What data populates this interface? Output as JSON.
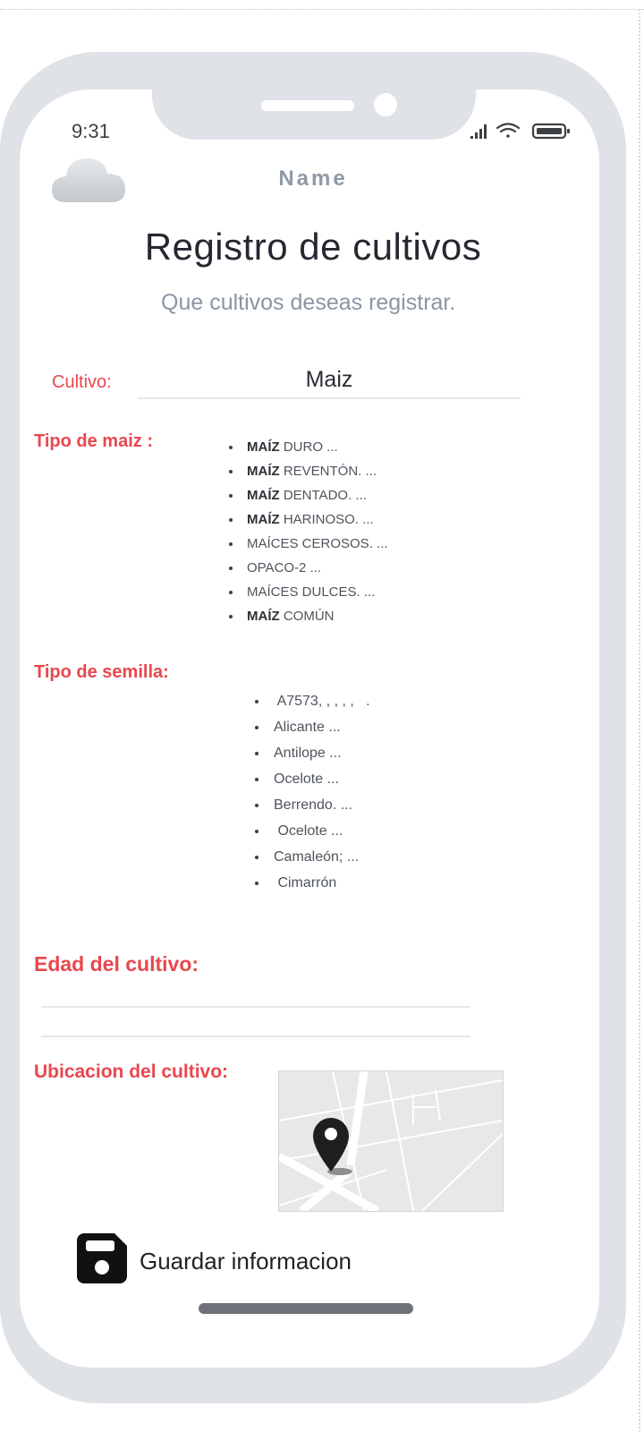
{
  "status_bar": {
    "time": "9:31",
    "icons": [
      "signal-icon",
      "wifi-icon",
      "battery-icon"
    ]
  },
  "header": {
    "logo_icon": "cloud-icon",
    "name": "Name",
    "title": "Registro de cultivos",
    "subtitle": "Que cultivos deseas registrar."
  },
  "form": {
    "cultivo": {
      "label": "Cultivo:",
      "value": "Maiz"
    },
    "tipo_maiz": {
      "label": "Tipo de maiz :",
      "items": [
        {
          "bold": "MAÍZ",
          "text": " DURO ..."
        },
        {
          "bold": "MAÍZ",
          "text": " REVENTÓN. ..."
        },
        {
          "bold": "MAÍZ",
          "text": " DENTADO. ..."
        },
        {
          "bold": "MAÍZ",
          "text": " HARINOSO. ..."
        },
        {
          "bold": "",
          "text": "MAÍCES CEROSOS. ..."
        },
        {
          "bold": "",
          "text": "OPACO-2 ..."
        },
        {
          "bold": "",
          "text": "MAÍCES DULCES. ..."
        },
        {
          "bold": "MAÍZ",
          "text": " COMÚN"
        }
      ]
    },
    "tipo_semilla": {
      "label": "Tipo de semilla:",
      "items": [
        " A7573, , , , ,   .",
        "Alicante ...",
        "Antilope ...",
        "Ocelote ...",
        "Berrendo. ...",
        " Ocelote ...",
        "Camaleón; ...",
        " Cimarrón"
      ]
    },
    "edad": {
      "label": "Edad del cultivo:",
      "value": ""
    },
    "ubicacion": {
      "label": "Ubicacion del cultivo:",
      "map_icon": "map-pin-icon"
    }
  },
  "actions": {
    "save_icon": "floppy-disk-icon",
    "save_label": "Guardar informacion"
  },
  "colors": {
    "accent_red": "#e8474e",
    "frame_gray": "#dfe3e7",
    "text_dark": "#252830",
    "text_muted": "#8a96a3"
  }
}
